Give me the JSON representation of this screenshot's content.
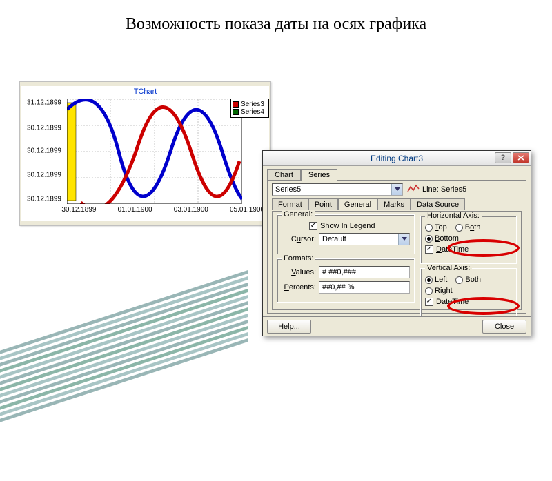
{
  "slide_title": "Возможность показа даты на осях графика",
  "chart": {
    "title": "TChart",
    "y_ticks": [
      "31.12.1899",
      "30.12.1899",
      "30.12.1899",
      "30.12.1899",
      "30.12.1899"
    ],
    "x_ticks": [
      "30.12.1899",
      "01.01.1900",
      "03.01.1900",
      "05.01.1900"
    ],
    "legend": [
      {
        "label": "Series3",
        "color": "#cc0000"
      },
      {
        "label": "Series4",
        "color": "#006600"
      }
    ]
  },
  "chart_data": {
    "type": "line",
    "title": "TChart",
    "xlabel": "",
    "ylabel": "",
    "x_axis_type": "datetime",
    "x_ticks": [
      "30.12.1899",
      "01.01.1900",
      "03.01.1900",
      "05.01.1900"
    ],
    "y_ticks": [
      "30.12.1899",
      "30.12.1899",
      "30.12.1899",
      "30.12.1899",
      "31.12.1899"
    ],
    "series": [
      {
        "name": "Series3",
        "color": "#cc0000",
        "shape": "sine",
        "phase_deg": 90
      },
      {
        "name": "Series4",
        "color": "#006600",
        "shape": "sine",
        "phase_deg": 0
      },
      {
        "name": "blue-curve",
        "color": "#0000cc",
        "shape": "sine",
        "phase_deg": 0
      }
    ]
  },
  "dialog": {
    "title": "Editing Chart3",
    "tabs_top": [
      "Chart",
      "Series"
    ],
    "tabs_top_active": 1,
    "series_select": "Series5",
    "line_label": "Line: Series5",
    "sub_tabs": [
      "Format",
      "Point",
      "General",
      "Marks",
      "Data Source"
    ],
    "sub_tabs_active": 2,
    "general": {
      "legend_title": "General:",
      "show_in_legend_label": "Show In Legend",
      "show_in_legend": true,
      "cursor_label": "Cursor:",
      "cursor_value": "Default"
    },
    "formats": {
      "legend_title": "Formats:",
      "values_label": "Values:",
      "values_value": "# ##0,###",
      "percents_label": "Percents:",
      "percents_value": "##0,## %"
    },
    "haxis": {
      "legend_title": "Horizontal Axis:",
      "top_label": "Top",
      "both_label": "Both",
      "bottom_label": "Bottom",
      "selected": "bottom",
      "datetime_label": "DateTime",
      "datetime": true
    },
    "vaxis": {
      "legend_title": "Vertical Axis:",
      "left_label": "Left",
      "both_label": "Both",
      "right_label": "Right",
      "selected": "left",
      "datetime_label": "DateTime",
      "datetime": true
    },
    "help_label": "Help...",
    "close_label": "Close"
  }
}
